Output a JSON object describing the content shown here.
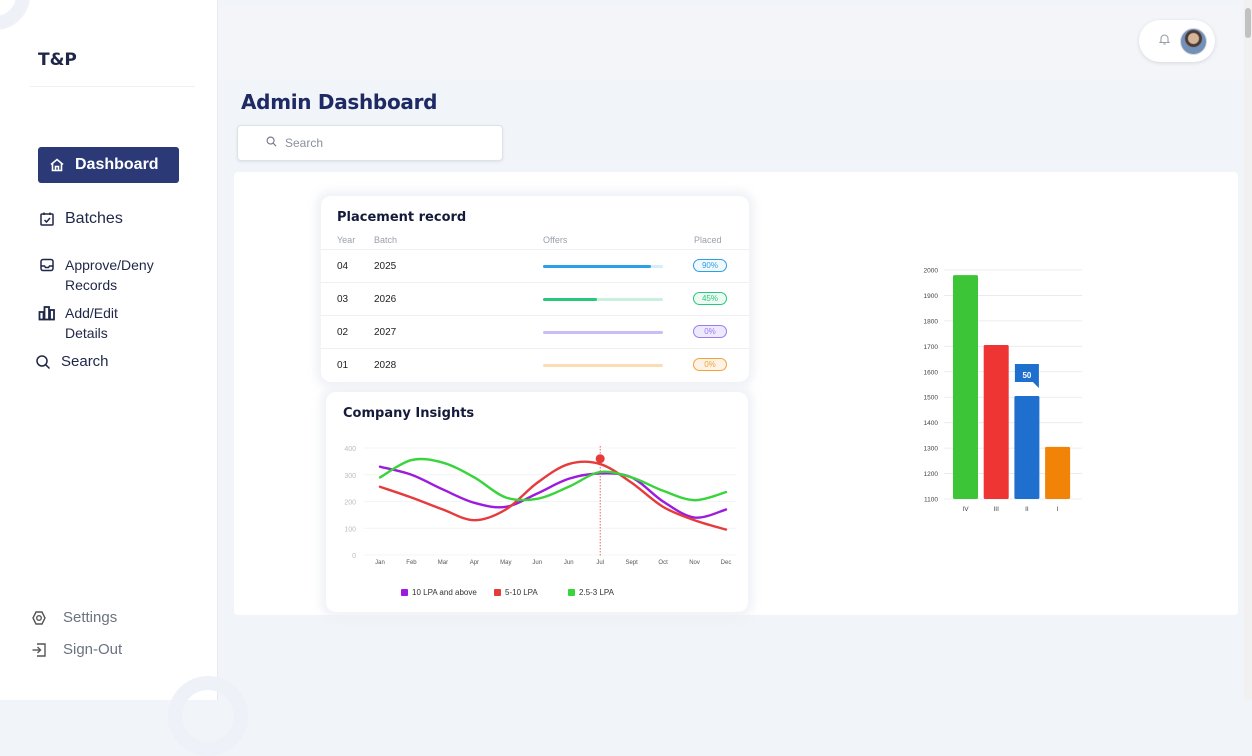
{
  "brand": "T&P",
  "nav": {
    "dashboard": "Dashboard",
    "batches": "Batches",
    "approve_line1": "Approve/Deny",
    "approve_line2": "Records",
    "add_line1": "Add/Edit",
    "add_line2": "Details",
    "search": "Search",
    "settings": "Settings",
    "signout": "Sign-Out"
  },
  "page_title": "Admin Dashboard",
  "search": {
    "placeholder": "Search"
  },
  "placement": {
    "title": "Placement record",
    "headers": {
      "year": "Year",
      "batch": "Batch",
      "offers": "Offers",
      "placed": "Placed"
    },
    "rows": [
      {
        "year": "04",
        "batch": "2025",
        "placed": "90%",
        "fraction": 0.9,
        "color": "#2aa0e6",
        "track": "#d7ecfa"
      },
      {
        "year": "03",
        "batch": "2026",
        "placed": "45%",
        "fraction": 0.45,
        "color": "#29c77b",
        "track": "#c9f1dd"
      },
      {
        "year": "02",
        "batch": "2027",
        "placed": "0%",
        "fraction": 0.0,
        "color": "#9b7cf0",
        "track": "#cbbcf6"
      },
      {
        "year": "01",
        "batch": "2028",
        "placed": "0%",
        "fraction": 0.0,
        "color": "#f3a23a",
        "track": "#fbdcb4"
      }
    ]
  },
  "insights": {
    "title": "Company Insights",
    "chart_data": {
      "type": "line",
      "x": [
        "Jan",
        "Feb",
        "Mar",
        "Apr",
        "May",
        "Jun",
        "Jun",
        "Jul",
        "Sept",
        "Oct",
        "Nov",
        "Dec"
      ],
      "yticks": [
        0,
        100,
        200,
        300,
        400
      ],
      "ylim": [
        0,
        400
      ],
      "series": [
        {
          "name": "10 LPA and above",
          "color": "#9c1bdc",
          "values": [
            330,
            300,
            245,
            195,
            180,
            230,
            285,
            305,
            290,
            200,
            140,
            170
          ]
        },
        {
          "name": "5-10 LPA",
          "color": "#e63b3b",
          "values": [
            255,
            215,
            170,
            130,
            170,
            270,
            340,
            340,
            270,
            180,
            130,
            95
          ]
        },
        {
          "name": "2.5-3 LPA",
          "color": "#37d43a",
          "values": [
            290,
            355,
            345,
            290,
            215,
            210,
            255,
            310,
            290,
            240,
            205,
            235
          ]
        }
      ],
      "highlight": {
        "x": "Jul",
        "value": 360
      }
    }
  },
  "bar": {
    "chart_data": {
      "type": "bar",
      "categories": [
        "IV",
        "III",
        "II",
        "I"
      ],
      "values": [
        1980,
        1705,
        1505,
        1305
      ],
      "colors": [
        "#3cc537",
        "#ef3434",
        "#1f6fcf",
        "#f18406"
      ],
      "ylim": [
        1100,
        2000
      ],
      "yticks": [
        1100,
        1200,
        1300,
        1400,
        1500,
        1600,
        1700,
        1800,
        1900,
        2000
      ],
      "callout": {
        "category": "II",
        "label": "50"
      }
    }
  }
}
